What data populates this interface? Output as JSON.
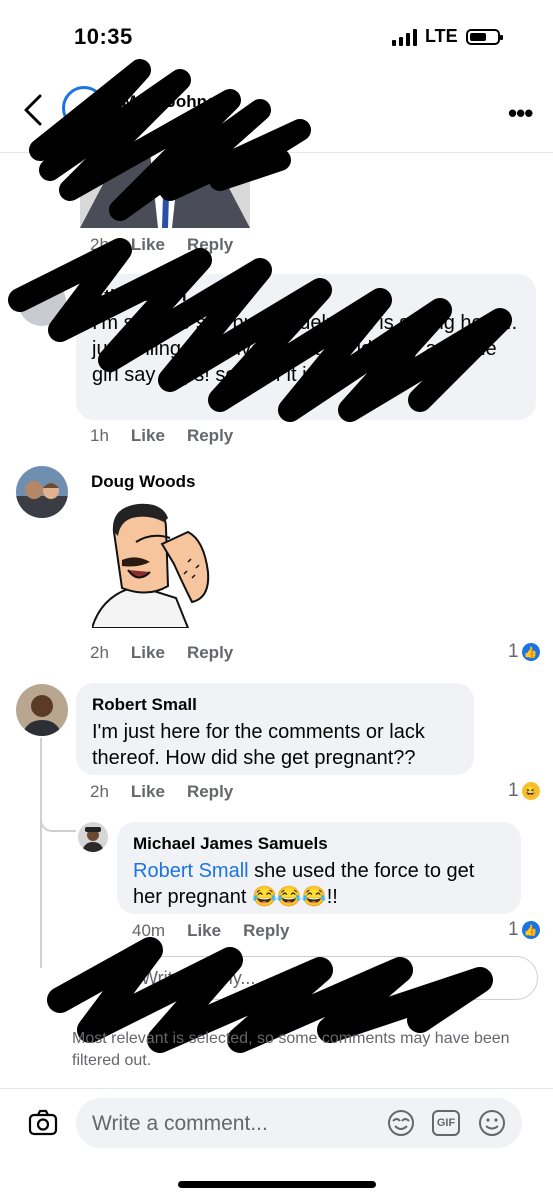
{
  "status_bar": {
    "time": "10:35",
    "network": "LTE"
  },
  "header": {
    "name": "Mark Johnson"
  },
  "comments": [
    {
      "time": "2h",
      "like": "Like",
      "reply": "Reply"
    },
    {
      "author": "Atia Person",
      "text": "I'm sorry to say but the delusion is strong here... just telling ourselves what we identify as... the girl say oops! so poof it is",
      "time": "1h",
      "like": "Like",
      "reply": "Reply"
    },
    {
      "author": "Doug Woods",
      "time": "2h",
      "like": "Like",
      "reply": "Reply",
      "reaction_count": "1",
      "reaction": "like"
    },
    {
      "author": "Robert Small",
      "text": "I'm just here for the comments or lack thereof. How did she get pregnant??",
      "time": "2h",
      "like": "Like",
      "reply": "Reply",
      "reaction_count": "1",
      "reaction": "haha"
    },
    {
      "author": "Michael James Samuels",
      "mention": "Robert Small",
      "text": " she used the force to get her pregnant ",
      "emoji": "😂😂😂",
      "suffix": "!!",
      "time": "40m",
      "like": "Like",
      "reply": "Reply",
      "reaction_count": "1",
      "reaction": "like"
    }
  ],
  "reply_placeholder": "Write a reply...",
  "filter_note": "Most relevant is selected, so some comments may have been filtered out.",
  "composer": {
    "placeholder": "Write a comment...",
    "gif_label": "GIF"
  },
  "colors": {
    "accent": "#1b74e4",
    "bubble": "#f0f2f5",
    "meta": "#65676b"
  }
}
